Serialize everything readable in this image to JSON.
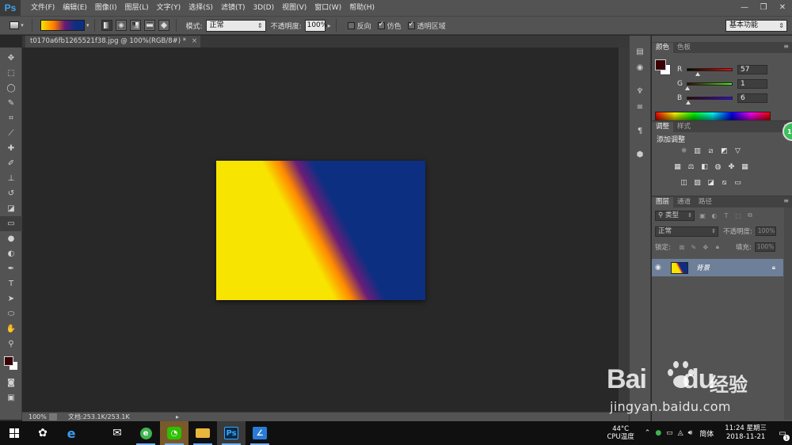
{
  "app": {
    "logo": "Ps"
  },
  "menu": [
    "文件(F)",
    "编辑(E)",
    "图像(I)",
    "图层(L)",
    "文字(Y)",
    "选择(S)",
    "滤镜(T)",
    "3D(D)",
    "视图(V)",
    "窗口(W)",
    "帮助(H)"
  ],
  "window_controls": {
    "minimize": "—",
    "restore": "❐",
    "close": "✕"
  },
  "options": {
    "mode_label": "模式:",
    "mode_value": "正常",
    "opacity_label": "不透明度:",
    "opacity_value": "100%",
    "reverse_label": "反向",
    "dither_label": "仿色",
    "transparency_label": "透明区域",
    "workspace": "基本功能"
  },
  "document_tab": {
    "title": "t0170a6fb1265521f38.jpg @ 100%(RGB/8#) *",
    "close": "×"
  },
  "status": {
    "zoom": "100%",
    "doc_info": "文档:253.1K/253.1K"
  },
  "color_panel": {
    "tabs": [
      "颜色",
      "色板"
    ],
    "sliders": [
      {
        "label": "R",
        "value": "57",
        "position": 0.224,
        "gradient": "linear-gradient(90deg,#000601,#ff0601)"
      },
      {
        "label": "G",
        "value": "1",
        "position": 0.004,
        "gradient": "linear-gradient(90deg,#390006,#39ff06)"
      },
      {
        "label": "B",
        "value": "6",
        "position": 0.024,
        "gradient": "linear-gradient(90deg,#390100,#3901ff)"
      }
    ],
    "foreground": "#390106",
    "background": "#ffffff"
  },
  "adjustments_panel": {
    "tabs": [
      "调整",
      "样式"
    ],
    "title": "添加调整"
  },
  "layers_panel": {
    "tabs": [
      "图层",
      "通道",
      "路径"
    ],
    "filter_label": "类型",
    "blend_mode": "正常",
    "opacity_label": "不透明度:",
    "opacity_value": "100%",
    "lock_label": "锁定:",
    "fill_label": "填充:",
    "fill_value": "100%",
    "layer_name": "背景"
  },
  "badge": "19",
  "watermark": {
    "logo": "Bai",
    "logo_du": "du",
    "cn": "经验",
    "url": "jingyan.baidu.com"
  },
  "taskbar": {
    "temperature": "44°C",
    "temp_label": "CPU温度",
    "ime": "简体",
    "time": "11:24 星期三",
    "date": "2018-11-21",
    "notification_count": "1"
  }
}
